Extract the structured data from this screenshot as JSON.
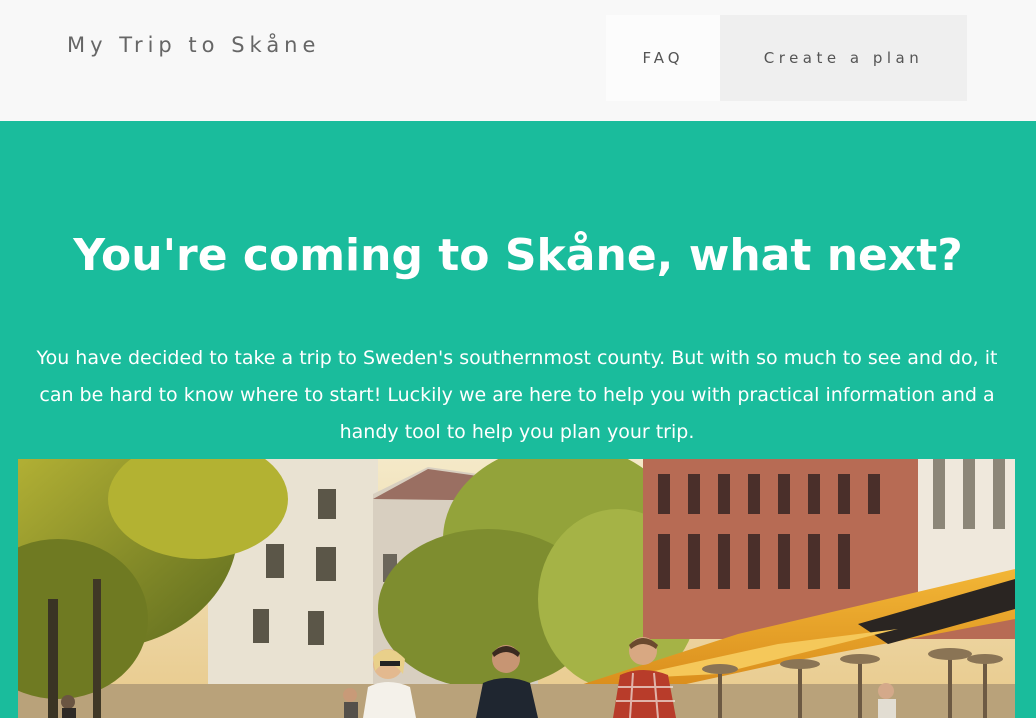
{
  "header": {
    "logo": "My Trip to Skåne",
    "nav": {
      "faq_label": "FAQ",
      "create_plan_label": "Create a plan"
    }
  },
  "hero": {
    "title": "You're coming to Skåne, what next?",
    "description": "You have decided to take a trip to Sweden's southernmost county. But with so much to see and do, it can be hard to know where to start! Luckily we are here to help you with practical information and a handy tool to help you plan your trip."
  },
  "colors": {
    "header_bg": "#f8f8f8",
    "hero_bg": "#1abc9c",
    "text_light": "#ffffff",
    "text_dark": "#666666"
  }
}
